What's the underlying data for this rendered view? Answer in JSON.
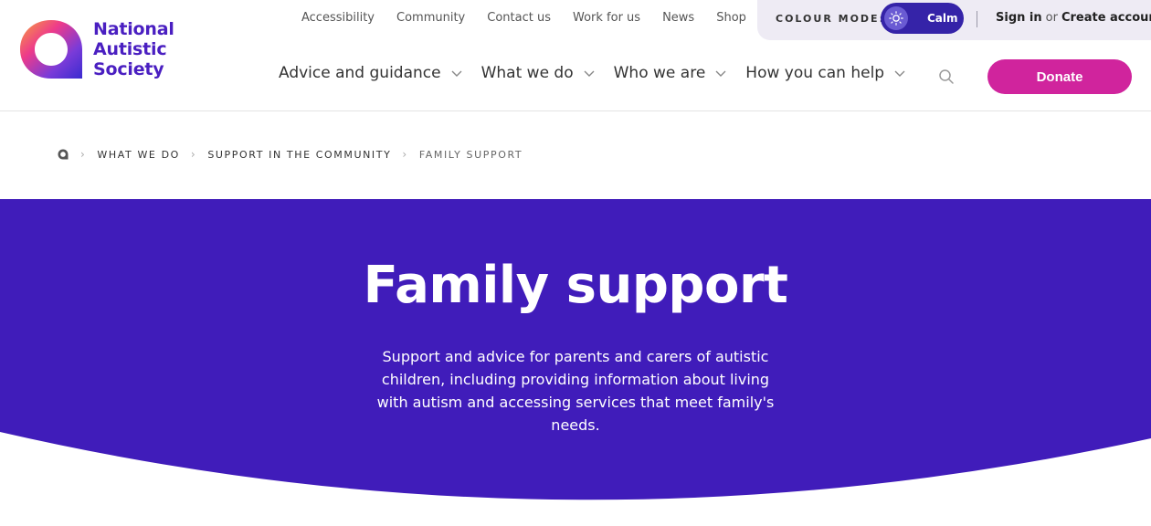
{
  "logo": {
    "line1": "National",
    "line2": "Autistic",
    "line3": "Society"
  },
  "top_nav": [
    "Accessibility",
    "Community",
    "Contact us",
    "Work for us",
    "News",
    "Shop"
  ],
  "colour_mode": {
    "label": "COLOUR MODE:",
    "mode": "Calm"
  },
  "account": {
    "sign_in": "Sign in",
    "or": "or",
    "create": "Create account"
  },
  "main_nav": [
    "Advice and guidance",
    "What we do",
    "Who we are",
    "How you can help"
  ],
  "donate_label": "Donate",
  "breadcrumb": {
    "items": [
      "WHAT WE DO",
      "SUPPORT IN THE COMMUNITY"
    ],
    "current": "FAMILY SUPPORT"
  },
  "hero": {
    "title": "Family support",
    "description": "Support and advice for parents and carers of autistic children, including providing information about living with autism and accessing services that meet family's needs."
  },
  "colors": {
    "brand_purple": "#4a1fc1",
    "hero_bg": "#401cba",
    "donate": "#d0249d"
  }
}
